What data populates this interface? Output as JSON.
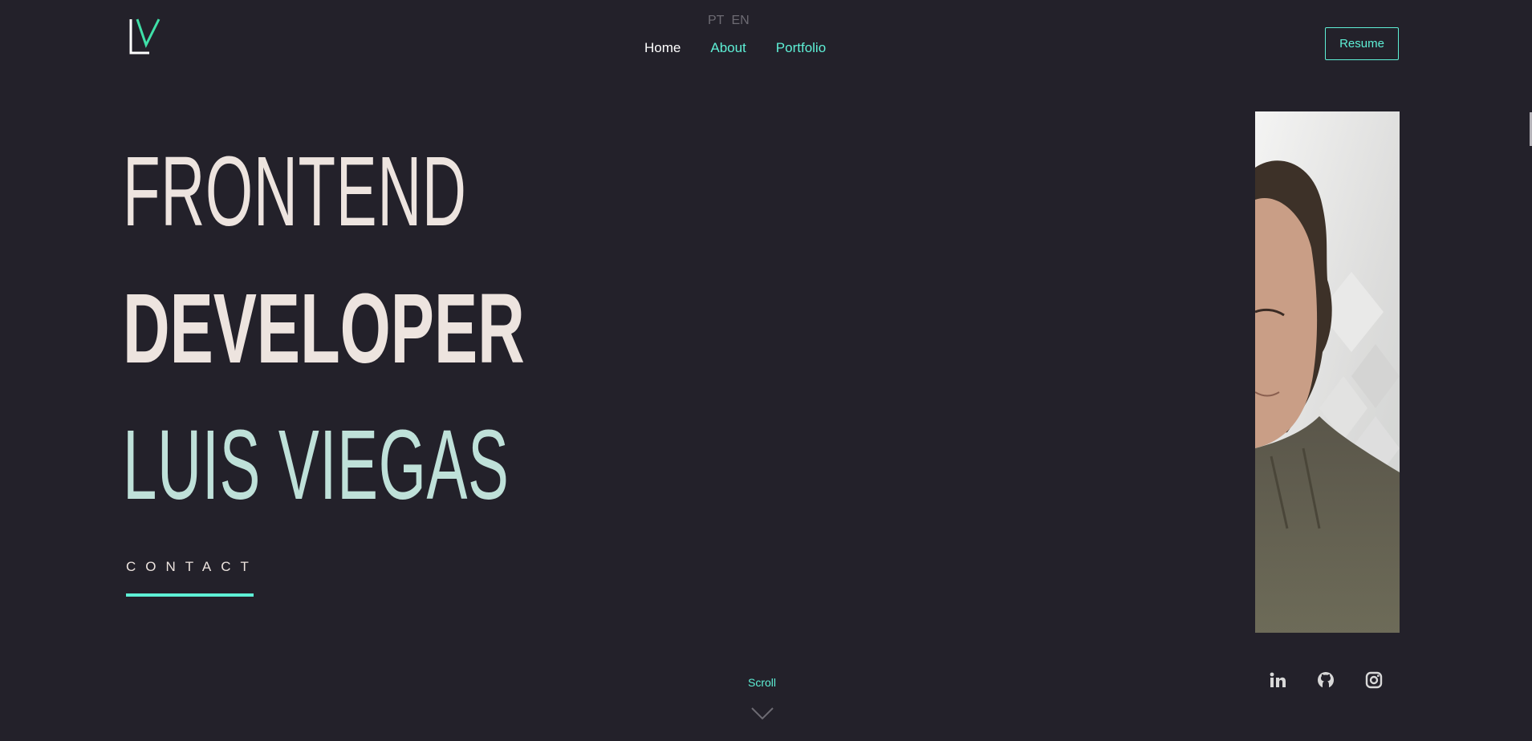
{
  "header": {
    "logo": {
      "letters": "LV",
      "colors": {
        "l": "#ffffff",
        "v": "#3fe0a8"
      }
    },
    "languages": [
      "PT",
      "EN"
    ],
    "nav": [
      {
        "label": "Home"
      },
      {
        "label": "About"
      },
      {
        "label": "Portfolio"
      }
    ],
    "resume_label": "Resume"
  },
  "hero": {
    "line1": "FRONTEND",
    "line2": "DEVELOPER",
    "line3": "LUIS VIEGAS",
    "contact_label": "CONTACT"
  },
  "scroll_label": "Scroll",
  "socials": [
    {
      "icon": "linkedin-icon"
    },
    {
      "icon": "github-icon"
    },
    {
      "icon": "instagram-icon"
    }
  ],
  "colors": {
    "background": "#23212a",
    "accent": "#5ef0d6",
    "text": "#ede4df",
    "name": "#bfe1d9"
  }
}
